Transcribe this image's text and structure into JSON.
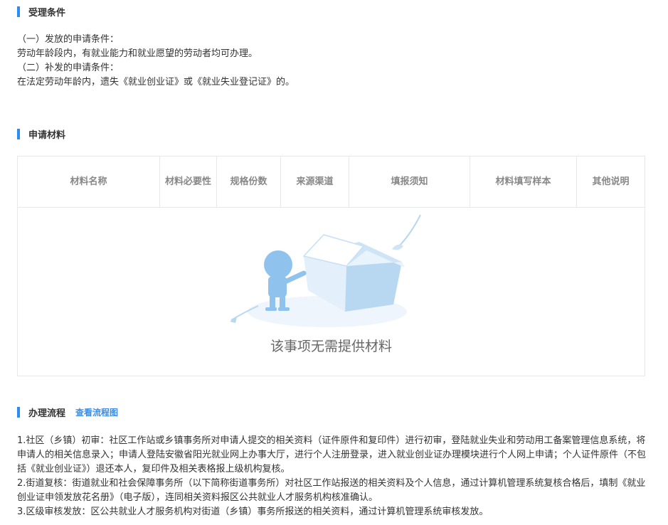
{
  "conditions": {
    "title": "受理条件",
    "lines": [
      "（一）发放的申请条件：",
      "劳动年龄段内，有就业能力和就业愿望的劳动者均可办理。",
      "（二）补发的申请条件：",
      "在法定劳动年龄内，遗失《就业创业证》或《就业失业登记证》的。"
    ]
  },
  "materials": {
    "title": "申请材料",
    "columns": [
      "材料名称",
      "材料必要性",
      "规格份数",
      "来源渠道",
      "填报须知",
      "材料填写样本",
      "其他说明"
    ],
    "empty_text": "该事项无需提供材料"
  },
  "process": {
    "title": "办理流程",
    "link": "查看流程图",
    "lines": [
      "1.社区（乡镇）初审：社区工作站或乡镇事务所对申请人提交的相关资料（证件原件和复印件）进行初审，登陆就业失业和劳动用工备案管理信息系统，将申请人的相关信息录入；申请人登陆安徽省阳光就业网上办事大厅，进行个人注册登录，进入就业创业证办理模块进行个人网上申请；个人证件原件（不包括《就业创业证》）退还本人，复印件及相关表格报上级机构复核。",
      "2.街道复核：街道就业和社会保障事务所（以下简称街道事务所）对社区工作站报送的相关资料及个人信息，通过计算机管理系统复核合格后，填制《就业创业证申领发放花名册》（电子版），连同相关资料报区公共就业人才服务机构核准确认。",
      "3.区级审核发放：区公共就业人才服务机构对街道（乡镇）事务所报送的相关资料，通过计算机管理系统审核发放。"
    ]
  },
  "colors": {
    "accent": "#2d8cf0",
    "link": "#3a8ee6",
    "illustration": "#a8d0f0"
  },
  "icons": {
    "empty": "empty-box-illustration-icon"
  }
}
